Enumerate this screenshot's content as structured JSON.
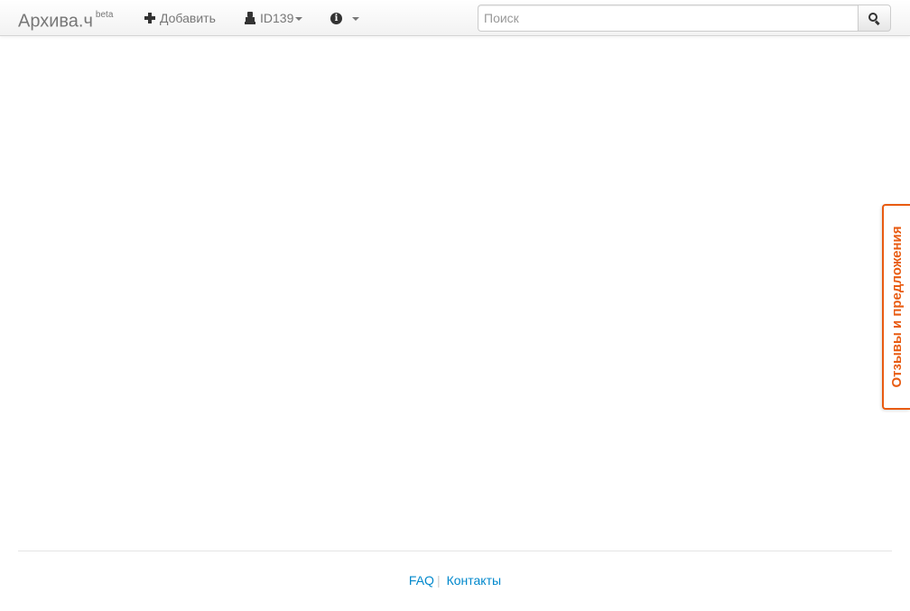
{
  "navbar": {
    "brand": "Архива.ч",
    "brand_badge": "beta",
    "add_label": "Добавить",
    "user_label": "ID139",
    "search_placeholder": "Поиск",
    "icons": {
      "add": "plus-icon",
      "user": "user-icon",
      "info": "info-icon",
      "search": "search-icon",
      "dropdown": "caret-down-icon"
    }
  },
  "feedback": {
    "label": "Отзывы и предложения",
    "accent_color": "#e85b11"
  },
  "footer": {
    "links": [
      {
        "label": "FAQ"
      },
      {
        "label": "Контакты"
      }
    ],
    "separator": "|",
    "link_color": "#0088cc"
  }
}
